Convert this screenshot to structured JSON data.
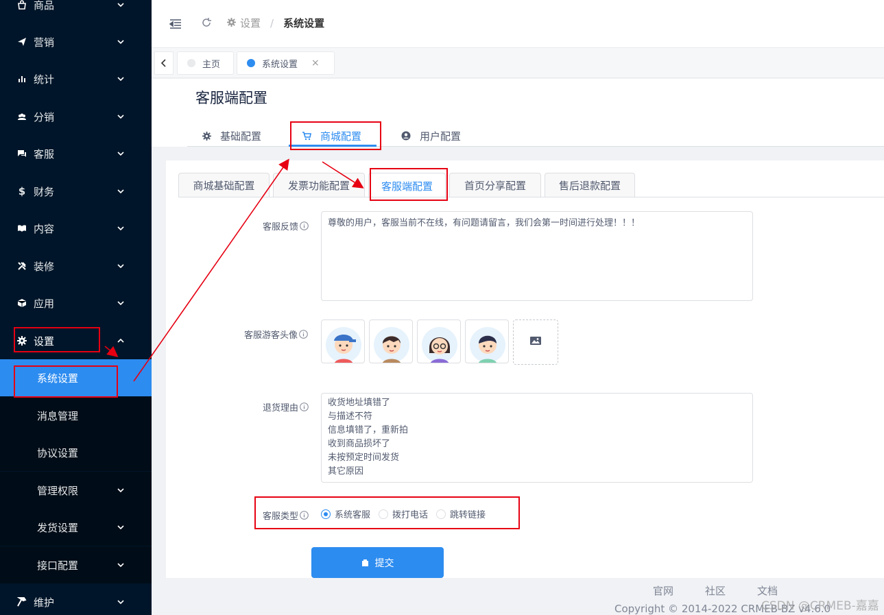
{
  "sidebar": {
    "items": [
      {
        "label": "商品",
        "icon": "bag-icon"
      },
      {
        "label": "营销",
        "icon": "send-icon"
      },
      {
        "label": "统计",
        "icon": "bar-chart-icon"
      },
      {
        "label": "分销",
        "icon": "users-icon"
      },
      {
        "label": "客服",
        "icon": "chat-icon"
      },
      {
        "label": "财务",
        "icon": "dollar-icon"
      },
      {
        "label": "内容",
        "icon": "book-icon"
      },
      {
        "label": "装修",
        "icon": "tools-icon"
      },
      {
        "label": "应用",
        "icon": "cube-icon"
      },
      {
        "label": "设置",
        "icon": "gear-icon"
      }
    ],
    "sub_items": [
      "系统设置",
      "消息管理",
      "协议设置",
      "管理权限",
      "发货设置",
      "接口配置"
    ],
    "last_item": {
      "label": "维护",
      "icon": "hammer-icon"
    }
  },
  "header": {
    "breadcrumb_parent": "设置",
    "breadcrumb_separator": "/",
    "breadcrumb_current": "系统设置"
  },
  "tags": {
    "home": "主页",
    "current": "系统设置",
    "close": "×"
  },
  "page": {
    "title": "客服端配置",
    "top_tabs": [
      "基础配置",
      "商城配置",
      "用户配置"
    ],
    "sub_tabs": [
      "商城基础配置",
      "发票功能配置",
      "客服端配置",
      "首页分享配置",
      "售后退款配置"
    ]
  },
  "form": {
    "feedback_label": "客服反馈",
    "feedback_value": "尊敬的用户，客服当前不在线，有问题请留言，我们会第一时间进行处理！！！",
    "avatar_label": "客服游客头像",
    "return_label": "退货理由",
    "return_value": "收货地址填错了\n与描述不符\n信息填错了，重新拍\n收到商品损坏了\n未按预定时间发货\n其它原因",
    "type_label": "客服类型",
    "type_options": [
      "系统客服",
      "拨打电话",
      "跳转链接"
    ],
    "type_selected": "系统客服",
    "submit": "提交"
  },
  "footer": {
    "links": [
      "官网",
      "社区",
      "文档"
    ],
    "copyright": "Copyright © 2014-2022 CRMEB-BZ v4.6.0",
    "watermark": "CSDN @CRMEB-嘉嘉"
  },
  "colors": {
    "accent": "#2d8cf0",
    "sidebar": "#001529",
    "annotation": "#e60012"
  }
}
